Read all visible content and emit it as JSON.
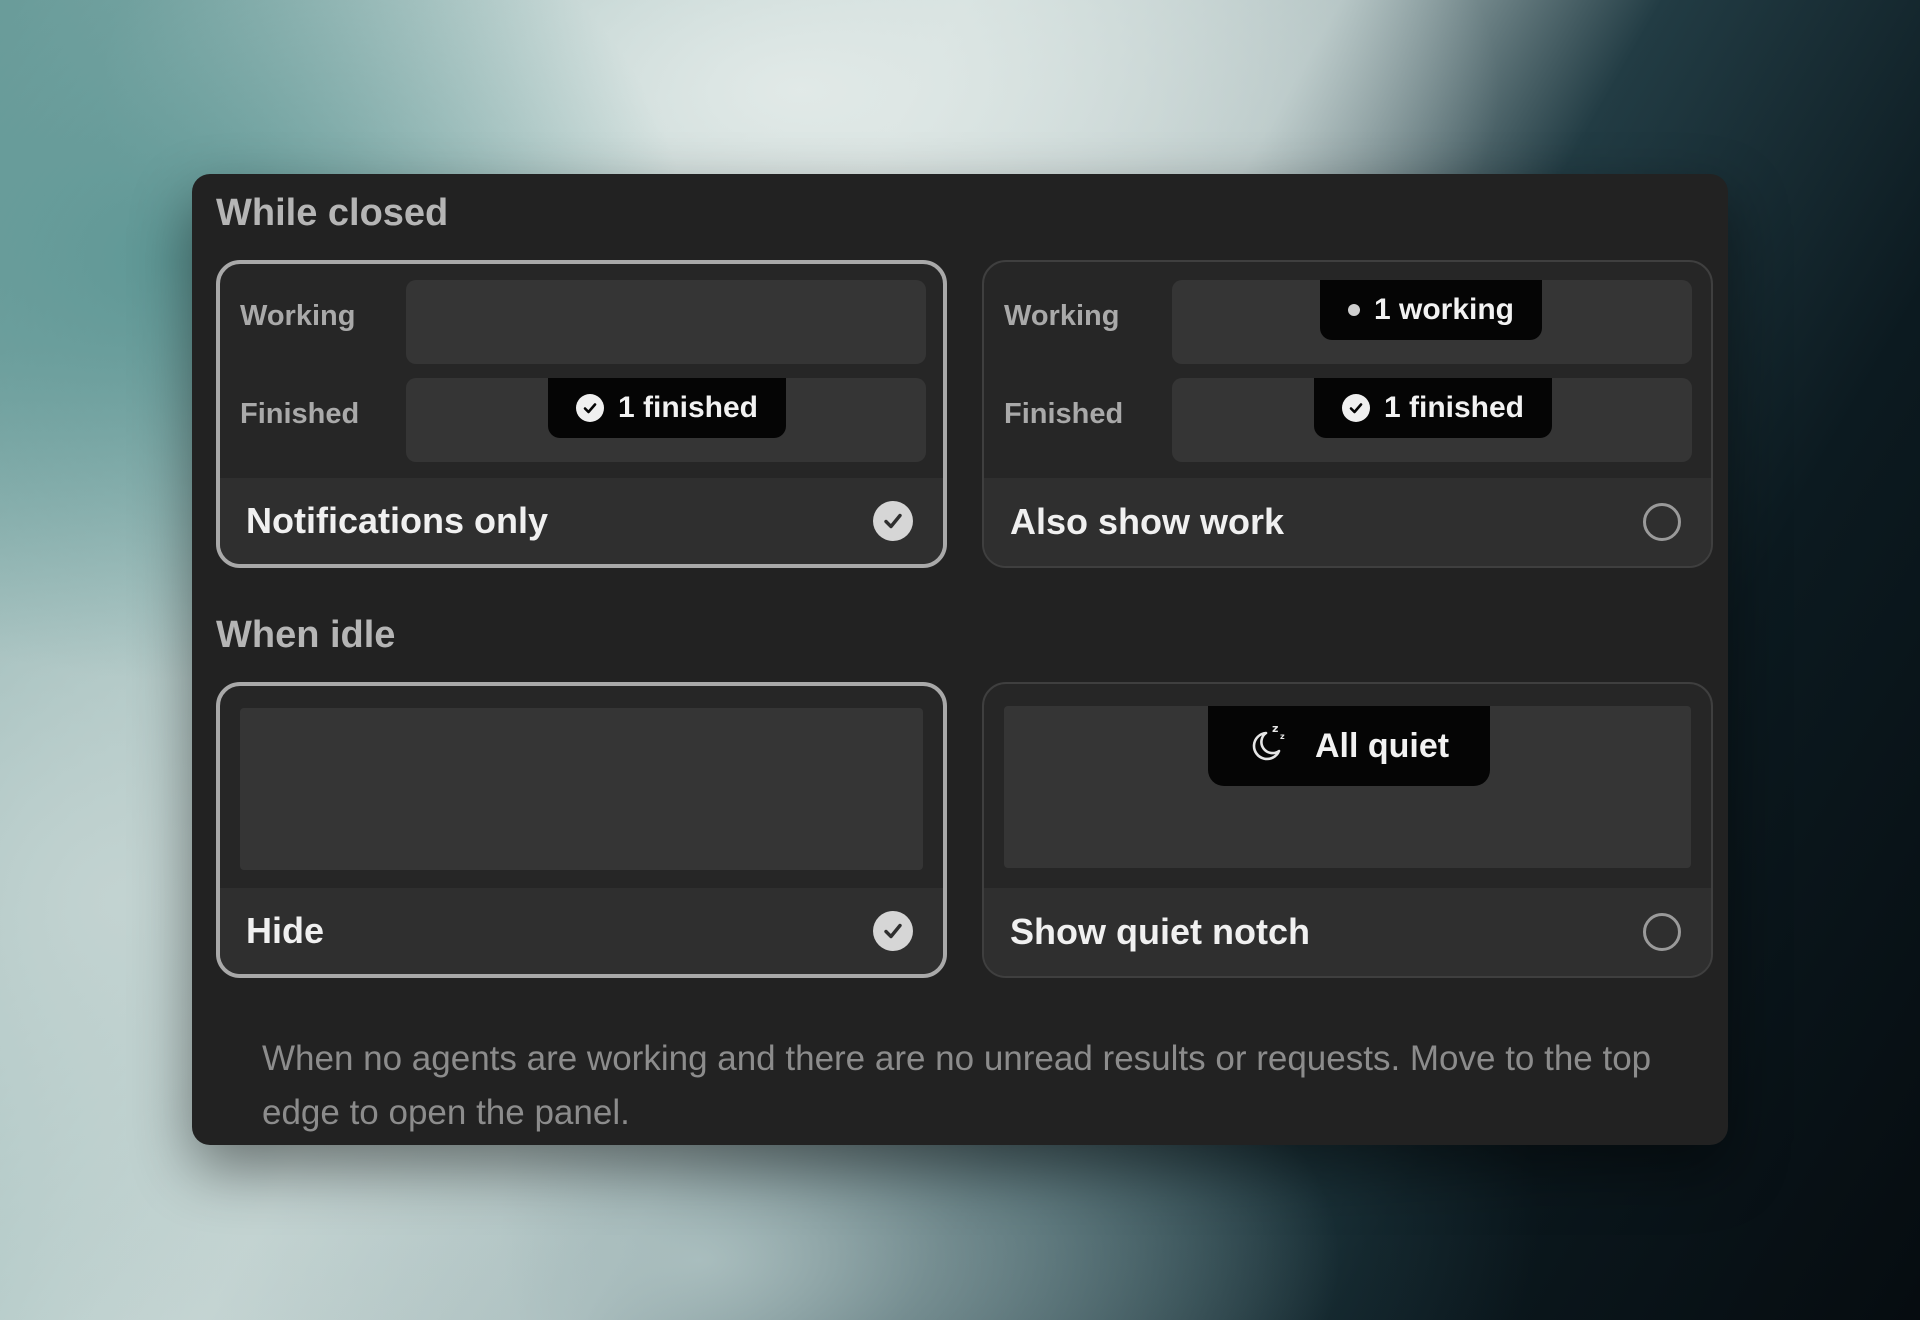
{
  "sections": {
    "closed": {
      "title": "While closed",
      "rows": {
        "working": "Working",
        "finished": "Finished"
      },
      "options": [
        {
          "label": "Notifications only",
          "selected": true,
          "working_badge": "",
          "finished_badge": "1 finished"
        },
        {
          "label": "Also show work",
          "selected": false,
          "working_badge": "1 working",
          "finished_badge": "1 finished"
        }
      ]
    },
    "idle": {
      "title": "When idle",
      "options": [
        {
          "label": "Hide",
          "selected": true
        },
        {
          "label": "Show quiet notch",
          "selected": false,
          "badge": "All quiet",
          "badge_icon": "moon-zzz-icon"
        }
      ],
      "description": "When no agents are working and there are no unread results or requests. Move to the top edge to open the panel."
    }
  },
  "colors": {
    "panel": "#222222",
    "selected_border": "#a9a9a9",
    "badge_bg": "#050505"
  }
}
